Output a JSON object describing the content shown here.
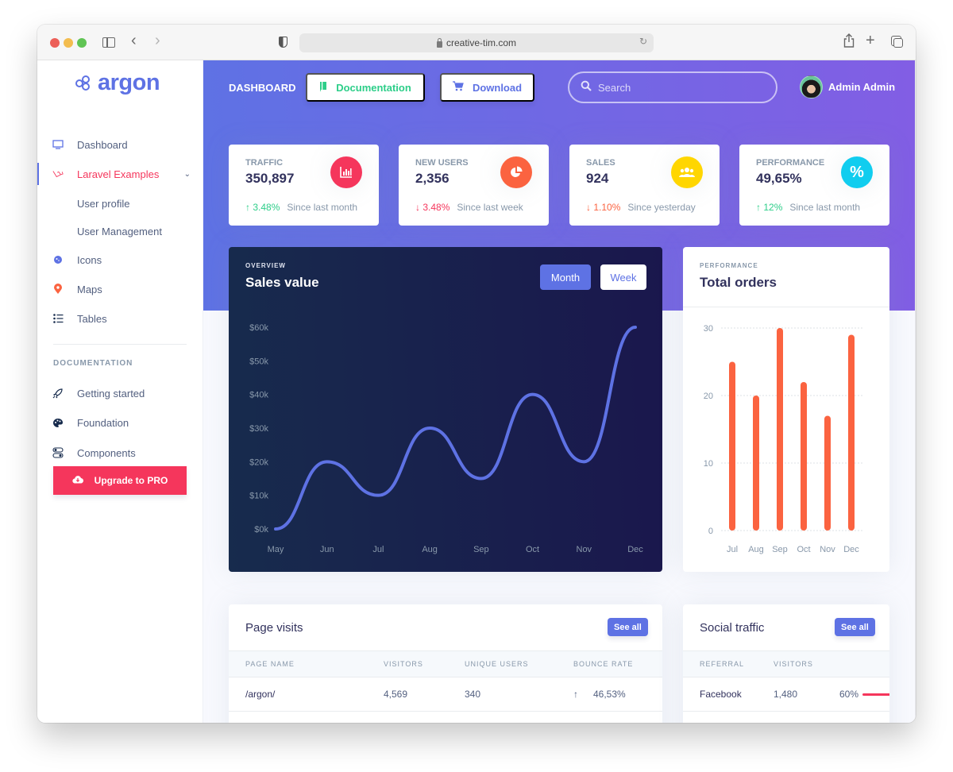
{
  "browser": {
    "url": "creative-tim.com"
  },
  "sidebar": {
    "logo_text": "argon",
    "items": [
      {
        "label": "Dashboard",
        "icon": "tv-icon",
        "active": false
      },
      {
        "label": "Laravel Examples",
        "icon": "laravel-icon",
        "active": true,
        "expanded": true
      },
      {
        "label": "User profile",
        "icon": "",
        "sub": true
      },
      {
        "label": "User Management",
        "icon": "",
        "sub": true
      },
      {
        "label": "Icons",
        "icon": "planet-icon"
      },
      {
        "label": "Maps",
        "icon": "map-pin-icon"
      },
      {
        "label": "Tables",
        "icon": "bullet-list-icon"
      }
    ],
    "documentation_heading": "DOCUMENTATION",
    "doc_items": [
      {
        "label": "Getting started",
        "icon": "rocket-icon"
      },
      {
        "label": "Foundation",
        "icon": "palette-icon"
      },
      {
        "label": "Components",
        "icon": "ui-components-icon"
      }
    ],
    "upgrade_label": "Upgrade to PRO"
  },
  "topbar": {
    "title": "DASHBOARD",
    "documentation_label": "Documentation",
    "download_label": "Download",
    "search_placeholder": "Search",
    "user_name": "Admin Admin"
  },
  "stats": [
    {
      "title": "TRAFFIC",
      "value": "350,897",
      "change": "3.48%",
      "direction": "up",
      "since": "Since last month",
      "icon": "bar-chart-icon",
      "color": "#f5365c"
    },
    {
      "title": "NEW USERS",
      "value": "2,356",
      "change": "3.48%",
      "direction": "down",
      "since": "Since last week",
      "icon": "pie-chart-icon",
      "color": "#fb6340"
    },
    {
      "title": "SALES",
      "value": "924",
      "change": "1.10%",
      "direction": "down",
      "since": "Since yesterday",
      "icon": "users-icon",
      "color": "#ffd600"
    },
    {
      "title": "PERFORMANCE",
      "value": "49,65%",
      "change": "12%",
      "direction": "up",
      "since": "Since last month",
      "icon": "percent-icon",
      "color": "#11cdef"
    }
  ],
  "sales_card": {
    "kicker": "OVERVIEW",
    "title": "Sales value",
    "month_label": "Month",
    "week_label": "Week",
    "selected": "Month"
  },
  "orders_card": {
    "kicker": "PERFORMANCE",
    "title": "Total orders"
  },
  "chart_data": [
    {
      "type": "line",
      "title": "Sales value",
      "categories": [
        "May",
        "Jun",
        "Jul",
        "Aug",
        "Sep",
        "Oct",
        "Nov",
        "Dec"
      ],
      "values": [
        0,
        20,
        10,
        30,
        15,
        40,
        20,
        60
      ],
      "yticks": [
        "$0k",
        "$10k",
        "$20k",
        "$30k",
        "$40k",
        "$50k",
        "$60k"
      ],
      "ylim": [
        0,
        60
      ],
      "xlabel": "",
      "ylabel": "",
      "color": "#5e72e4",
      "grid": false
    },
    {
      "type": "bar",
      "title": "Total orders",
      "categories": [
        "Jul",
        "Aug",
        "Sep",
        "Oct",
        "Nov",
        "Dec"
      ],
      "values": [
        25,
        20,
        30,
        22,
        17,
        29
      ],
      "yticks": [
        "0",
        "10",
        "20",
        "30"
      ],
      "ylim": [
        0,
        30
      ],
      "xlabel": "",
      "ylabel": "",
      "color": "#fb6340",
      "grid": true
    }
  ],
  "page_visits": {
    "title": "Page visits",
    "see_all": "See all",
    "columns": [
      "PAGE NAME",
      "VISITORS",
      "UNIQUE USERS",
      "BOUNCE RATE"
    ],
    "rows": [
      {
        "page": "/argon/",
        "visitors": "4,569",
        "unique": "340",
        "bounce": "46,53%",
        "direction": "up"
      }
    ]
  },
  "social_traffic": {
    "title": "Social traffic",
    "see_all": "See all",
    "columns": [
      "REFERRAL",
      "VISITORS"
    ],
    "rows": [
      {
        "referral": "Facebook",
        "visitors": "1,480",
        "percent": "60%",
        "progress": 60
      }
    ]
  }
}
